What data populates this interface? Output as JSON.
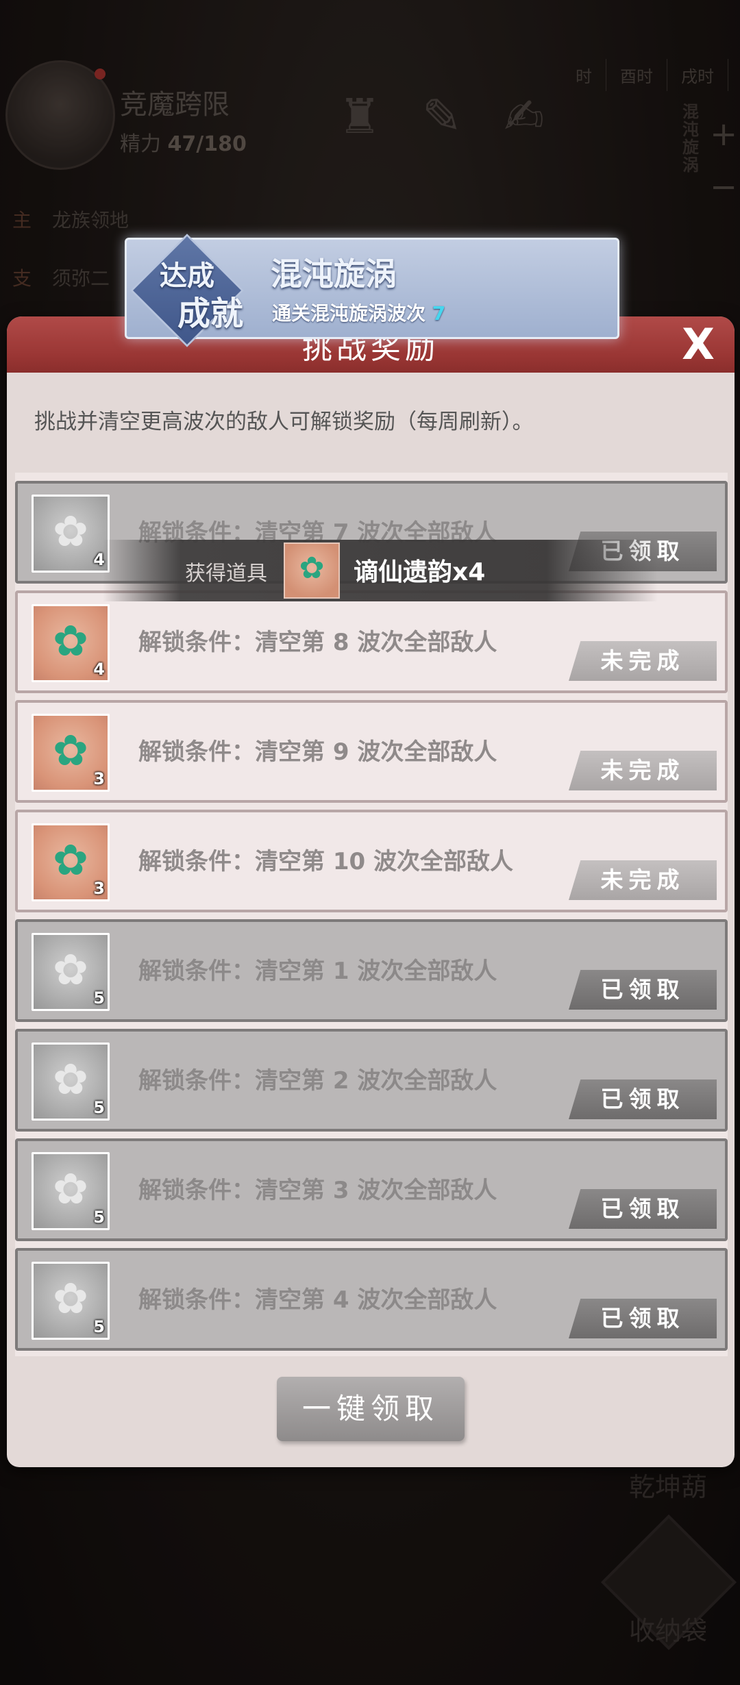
{
  "hud": {
    "player_name": "竞魔跨限",
    "stamina_label": "精力",
    "stamina_value": "47/180",
    "time_tabs": [
      "时",
      "酉时",
      "戌时"
    ],
    "side_label": "混沌旋涡",
    "quests": [
      {
        "tag": "主",
        "text": "龙族领地"
      },
      {
        "tag": "支",
        "text": "须弥二"
      }
    ],
    "gourd_label": "乾坤葫",
    "bag_label": "收纳袋"
  },
  "achievement": {
    "badge_line1": "达成",
    "badge_line2": "成就",
    "title": "混沌旋涡",
    "desc": "通关混沌旋涡波次",
    "desc_value": "7"
  },
  "panel": {
    "title": "挑战奖励",
    "close": "X",
    "desc": "挑战并清空更高波次的敌人可解锁奖励（每周刷新）。",
    "claim_all": "一键领取"
  },
  "toast": {
    "label": "获得道具",
    "item": "谪仙遗韵x4"
  },
  "rows": [
    {
      "condition": "解锁条件：清空第 7 波次全部敌人",
      "count": "4",
      "state": "done",
      "button": "已领取"
    },
    {
      "condition": "解锁条件：清空第 8 波次全部敌人",
      "count": "4",
      "state": "todo",
      "button": "未完成"
    },
    {
      "condition": "解锁条件：清空第 9 波次全部敌人",
      "count": "3",
      "state": "todo",
      "button": "未完成"
    },
    {
      "condition": "解锁条件：清空第 10 波次全部敌人",
      "count": "3",
      "state": "todo",
      "button": "未完成"
    },
    {
      "condition": "解锁条件：清空第 1 波次全部敌人",
      "count": "5",
      "state": "done",
      "button": "已领取"
    },
    {
      "condition": "解锁条件：清空第 2 波次全部敌人",
      "count": "5",
      "state": "done",
      "button": "已领取"
    },
    {
      "condition": "解锁条件：清空第 3 波次全部敌人",
      "count": "5",
      "state": "done",
      "button": "已领取"
    },
    {
      "condition": "解锁条件：清空第 4 波次全部敌人",
      "count": "5",
      "state": "done",
      "button": "已领取"
    }
  ],
  "icons": {
    "reward_item": "crystal-flower-icon"
  },
  "colors": {
    "panel_header": "#9a3634",
    "accent_number": "#46d6ee",
    "pending_item": "#d99478"
  }
}
